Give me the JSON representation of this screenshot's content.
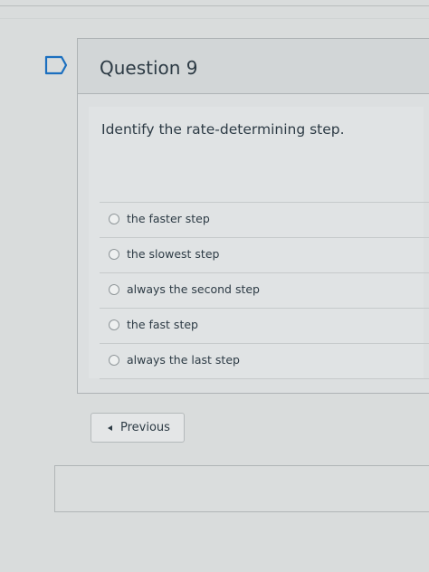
{
  "question": {
    "title": "Question 9",
    "text": "Identify the rate-determining step.",
    "answers": [
      {
        "label": "the faster step",
        "selected": false
      },
      {
        "label": "the slowest step",
        "selected": false
      },
      {
        "label": "always the second step",
        "selected": false
      },
      {
        "label": "the fast step",
        "selected": false
      },
      {
        "label": "always the last step",
        "selected": false
      }
    ]
  },
  "navigation": {
    "previous_label": "Previous"
  },
  "icons": {
    "flag": "flag-bookmark-icon",
    "previous": "caret-left-icon",
    "radio": "radio-button-unselected"
  },
  "colors": {
    "text": "#2d3b45",
    "accent_flag": "#1b6fbf",
    "background": "#d9dcdc"
  }
}
